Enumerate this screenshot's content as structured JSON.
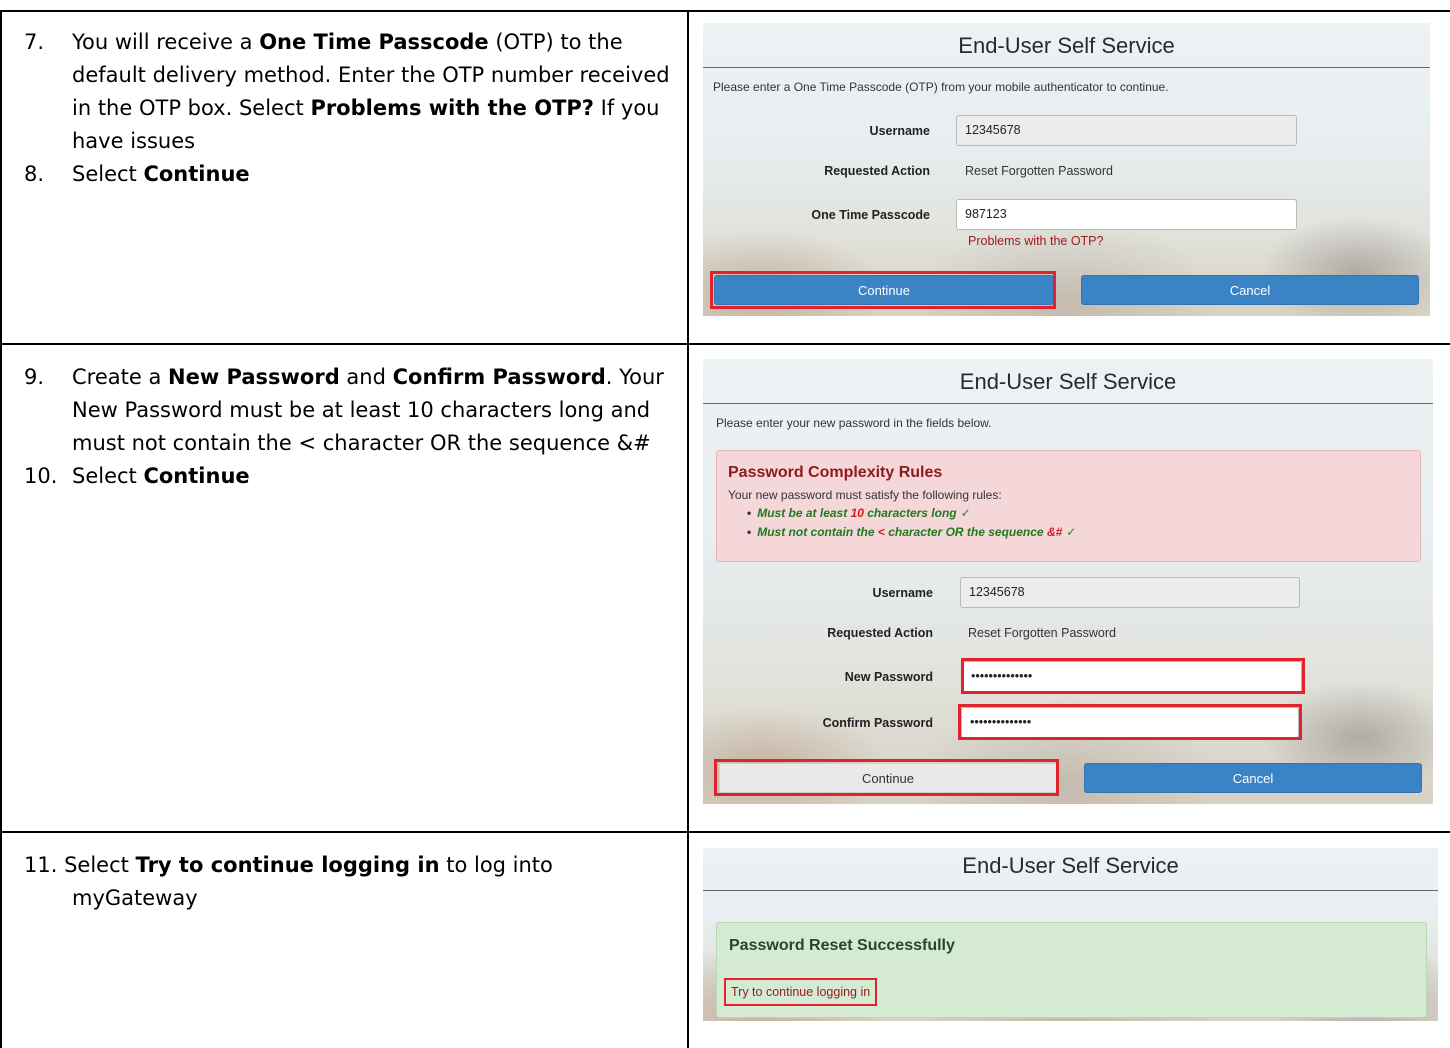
{
  "steps": {
    "s7": {
      "num": "7.",
      "t1": "You will receive a ",
      "b1": "One Time Passcode",
      "t2": " (OTP) to the default delivery method. Enter the OTP number received in the OTP box. Select ",
      "b2": "Problems with the OTP?",
      "t3": " If you have issues"
    },
    "s8": {
      "num": "8.",
      "t1": "Select ",
      "b1": "Continue"
    },
    "s9": {
      "num": "9.",
      "t1": "Create a ",
      "b1": "New Password",
      "t2": " and ",
      "b2": "Confirm Password",
      "t3": ". Your New Password must be at least 10 characters long and must not contain the < character OR the sequence &#"
    },
    "s10": {
      "num": "10.",
      "t1": "Select ",
      "b1": "Continue"
    },
    "s11": {
      "num": "11.",
      "t1": " Select ",
      "b1": "Try to continue logging in",
      "t2": " to log into",
      "t3": "myGateway"
    }
  },
  "shot1": {
    "title": "End-User Self Service",
    "intro": "Please enter a One Time Passcode (OTP) from your mobile authenticator to continue.",
    "username_label": "Username",
    "username_value": "12345678",
    "action_label": "Requested Action",
    "action_value": "Reset Forgotten Password",
    "otp_label": "One Time Passcode",
    "otp_value": "987123",
    "otp_link": "Problems with the OTP?",
    "continue": "Continue",
    "cancel": "Cancel"
  },
  "shot2": {
    "title": "End-User Self Service",
    "intro": "Please enter your new password in the fields below.",
    "rules_title": "Password Complexity Rules",
    "rules_sub": "Your new password must satisfy the following rules:",
    "rule1_a": "Must be at least ",
    "rule1_b": "10",
    "rule1_c": " characters long",
    "rule2_a": "Must not contain the ",
    "rule2_b": "<",
    "rule2_c": " character OR the sequence ",
    "rule2_d": "&#",
    "check": "✓",
    "bullet": "•",
    "username_label": "Username",
    "username_value": "12345678",
    "action_label": "Requested Action",
    "action_value": "Reset Forgotten Password",
    "newpw_label": "New Password",
    "newpw_value": "••••••••••••••",
    "confirm_label": "Confirm Password",
    "confirm_value": "••••••••••••••",
    "continue": "Continue",
    "cancel": "Cancel"
  },
  "shot3": {
    "title": "End-User Self Service",
    "success": "Password Reset Successfully",
    "link": "Try to continue logging in"
  },
  "colors": {
    "highlight": "#e0232c",
    "primary_button": "#3a83c5",
    "error_alert": "#f5d7d9",
    "success_alert": "#d4ead2",
    "link": "#9b1b1b"
  }
}
